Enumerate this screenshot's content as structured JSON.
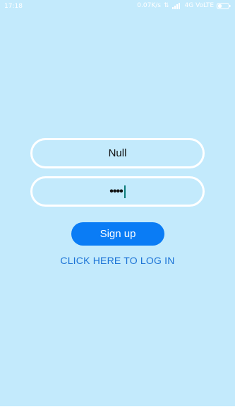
{
  "status_bar": {
    "time": "17:18",
    "network_speed": "0.07K/s",
    "network_type": "4G VoLTE"
  },
  "form": {
    "name_value": "Null",
    "password_value": "••••",
    "signup_label": "Sign up",
    "login_link_label": "CLICK HERE TO LOG IN"
  },
  "colors": {
    "background": "#c3eafc",
    "input_border": "#ffffff",
    "button": "#0a7cf5",
    "link": "#1b73d6"
  }
}
